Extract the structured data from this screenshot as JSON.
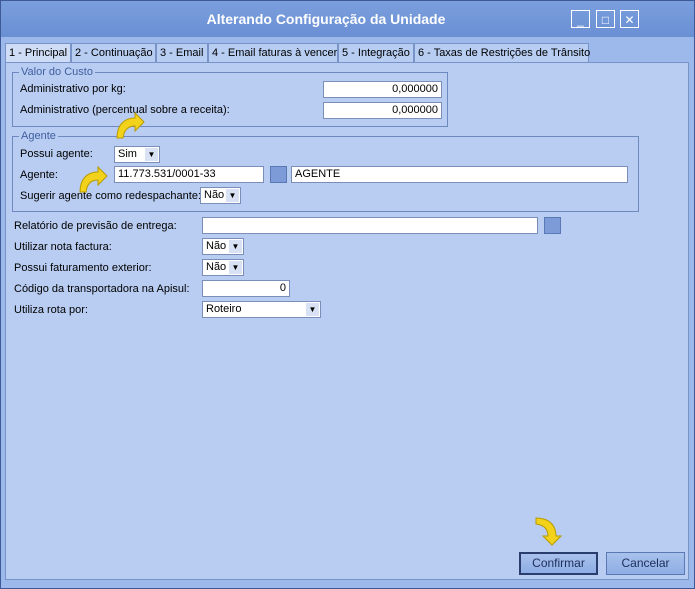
{
  "window": {
    "title": "Alterando Configuração da Unidade",
    "controls": {
      "minimize": "_",
      "maximize": "□",
      "close": "✕"
    }
  },
  "tabs": [
    {
      "label": "1 - Principal"
    },
    {
      "label": "2 - Continuação"
    },
    {
      "label": "3 - Email"
    },
    {
      "label": "4 - Email faturas à vencer"
    },
    {
      "label": "5 - Integração"
    },
    {
      "label": "6 - Taxas de Restrições de Trânsito"
    }
  ],
  "valor_custo": {
    "legend": "Valor do Custo",
    "admin_kg_label": "Administrativo por kg:",
    "admin_kg_value": "0,000000",
    "admin_pct_label": "Administrativo (percentual sobre a receita):",
    "admin_pct_value": "0,000000"
  },
  "agente": {
    "legend": "Agente",
    "possui_label": "Possui agente:",
    "possui_value": "Sim",
    "agente_label": "Agente:",
    "agente_cnpj": "11.773.531/0001-33",
    "agente_name": "AGENTE",
    "sugerir_label": "Sugerir agente como redespachante:",
    "sugerir_value": "Não"
  },
  "fields": {
    "relatorio_label": "Relatório de previsão de entrega:",
    "relatorio_value": "",
    "nota_label": "Utilizar nota factura:",
    "nota_value": "Não",
    "faturamento_label": "Possui faturamento exterior:",
    "faturamento_value": "Não",
    "codigo_label": "Código da transportadora na Apisul:",
    "codigo_value": "0",
    "rota_label": "Utiliza rota por:",
    "rota_value": "Roteiro"
  },
  "buttons": {
    "confirmar": "Confirmar",
    "cancelar": "Cancelar"
  },
  "colors": {
    "titlebar": "#7b9fdd",
    "panel": "#b9cdf2",
    "pointer": "#f2d21b"
  }
}
